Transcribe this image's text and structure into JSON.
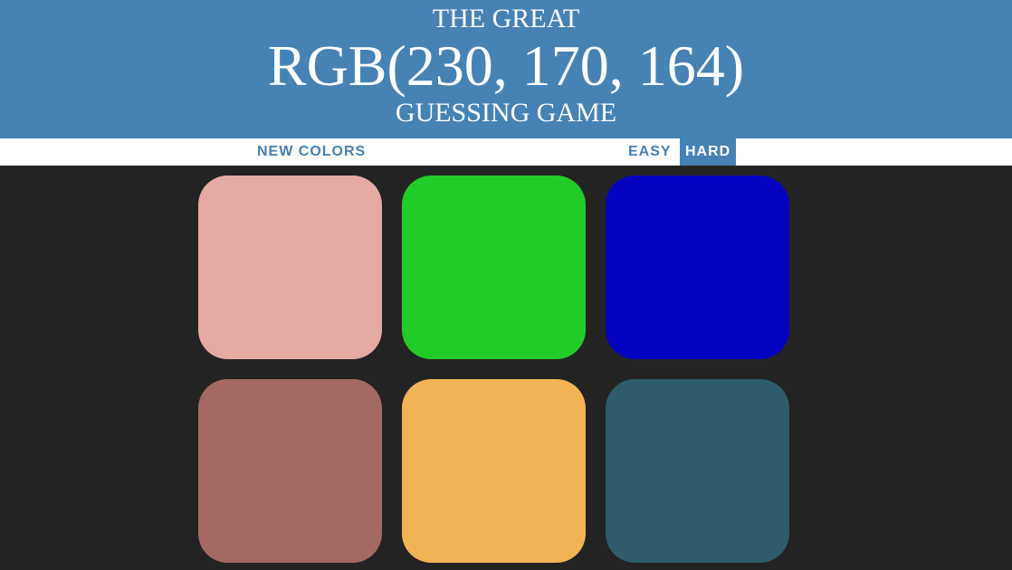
{
  "header": {
    "title_top": "THE GREAT",
    "rgb_display": "RGB(230, 170, 164)",
    "title_bottom": "GUESSING GAME",
    "bg_color": "#4682b4"
  },
  "controls": {
    "new_colors": "NEW COLORS",
    "message": "",
    "easy": "EASY",
    "hard": "HARD",
    "selected_mode": "hard"
  },
  "board": {
    "bg_color": "#232323",
    "squares": [
      {
        "color": "#e6aaa4"
      },
      {
        "color": "#22cc28"
      },
      {
        "color": "#0503bf"
      },
      {
        "color": "#a36962"
      },
      {
        "color": "#f2b354"
      },
      {
        "color": "#2f5c6a"
      }
    ]
  }
}
